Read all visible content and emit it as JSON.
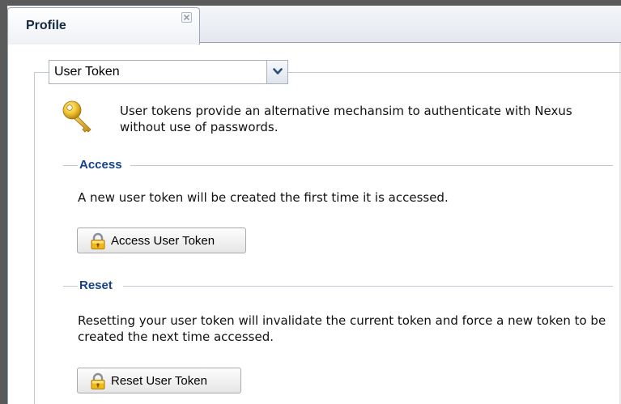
{
  "tab": {
    "title": "Profile"
  },
  "profile_select": {
    "value": "User Token"
  },
  "intro": {
    "text": "User tokens provide an alternative mechansim to authenticate with Nexus without use of passwords."
  },
  "access": {
    "legend": "Access",
    "text": "A new user token will be created the first time it is accessed.",
    "button_label": "Access User Token"
  },
  "reset": {
    "legend": "Reset",
    "text": "Resetting your user token will invalidate the current token and force a new token to be created the next time accessed.",
    "button_label": "Reset User Token"
  },
  "icons": {
    "intro": "key-icon",
    "buttons": "padlock-icon",
    "tab_close": "close-icon",
    "select_trigger": "chevron-down-icon"
  },
  "colors": {
    "legend": "#15428b",
    "tab_title": "#15283f",
    "border": "#99a4b3"
  }
}
